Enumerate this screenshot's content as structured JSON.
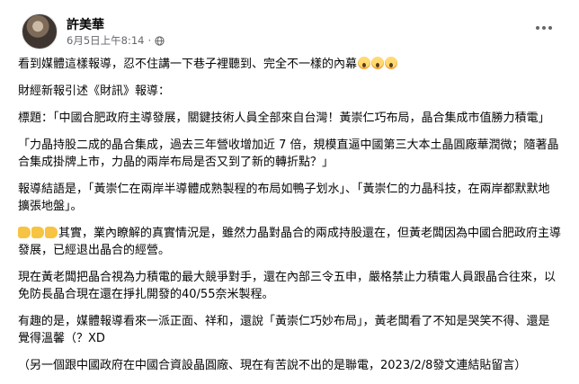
{
  "post": {
    "author": "許美華",
    "timestamp": "6月5日上午8:14",
    "separator": "·",
    "audience_icon": "globe-icon",
    "more_icon": "more-options-icon",
    "paragraphs": [
      "看到媒體這樣報導，忍不住講一下巷子裡聽到、完全不一樣的內幕",
      "財經新報引述《財訊》報導：",
      "標題：「中國合肥政府主導發展，關鍵技術人員全部來自台灣！黃崇仁巧布局，晶合集成市值勝力積電」",
      "「力晶持股二成的晶合集成，過去三年營收增加近 7 倍，規模直逼中國第三大本土晶圓廠華潤微；隨著晶合集成掛牌上市，力晶的兩岸布局是否又到了新的轉折點？」",
      "報導結語是，「黃崇仁在兩岸半導體成熟製程的布局如鴨子划水」、「黃崇仁的力晶科技，在兩岸都默默地擴張地盤」。",
      "其實，業內瞭解的真實情況是，雖然力晶對晶合的兩成持股還在，但黃老闆因為中國合肥政府主導發展，已經退出晶合的經營。",
      "現在黃老闆把晶合視為力積電的最大競爭對手，還在內部三令五申，嚴格禁止力積電人員跟晶合往來，以免防長晶合現在還在掙扎開發的40/55奈米製程。",
      "有趣的是，媒體報導看來一派正面、祥和，還說「黃崇仁巧妙布局」，黃老闆看了不知是哭笑不得、還是覺得溫馨（？XD",
      "（另一個跟中國政府在中國合資設晶圓廠、現在有苦說不出的是聯電，2023/2/8發文連結貼留言）"
    ],
    "emoji_count": 3,
    "hand_emoji_count": 3
  }
}
